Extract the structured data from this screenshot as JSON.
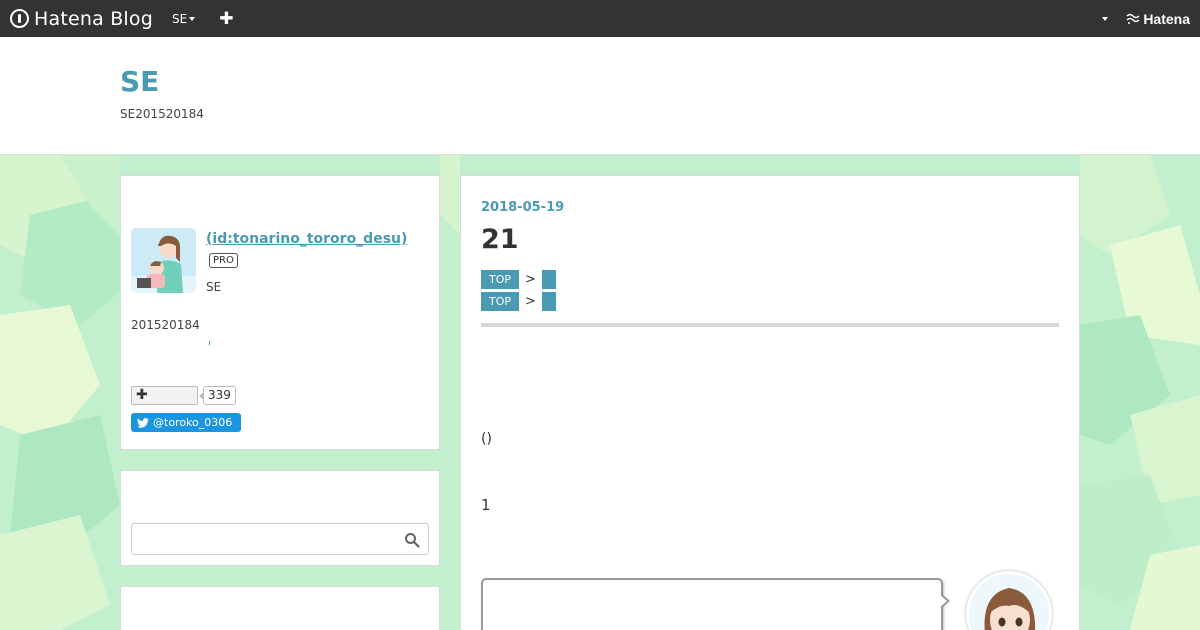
{
  "navbar": {
    "brand": "Hatena Blog",
    "blog_menu": "SE",
    "add_icon": "plus-icon",
    "hatena_logo": "Hatena"
  },
  "header": {
    "title": "SE",
    "description": "SE201520184"
  },
  "profile": {
    "id_link": " (id:tonarino_tororo_desu)",
    "badge": "PRO",
    "subtitle": "SE",
    "intro": "201520184",
    "follow_count": "339",
    "twitter_handle": "@toroko_0306"
  },
  "search": {
    "placeholder": ""
  },
  "entry": {
    "date": "2018-05-19",
    "title": "21",
    "breadcrumbs": [
      {
        "top": "TOP",
        "sep": ">"
      },
      {
        "top": "TOP",
        "sep": ">"
      }
    ],
    "paren_text": "()",
    "body_number": "1"
  },
  "colors": {
    "accent": "#4a9ab3",
    "navbar": "#333333",
    "background_pattern": "#bdeec9",
    "twitter": "#1b95e0"
  }
}
